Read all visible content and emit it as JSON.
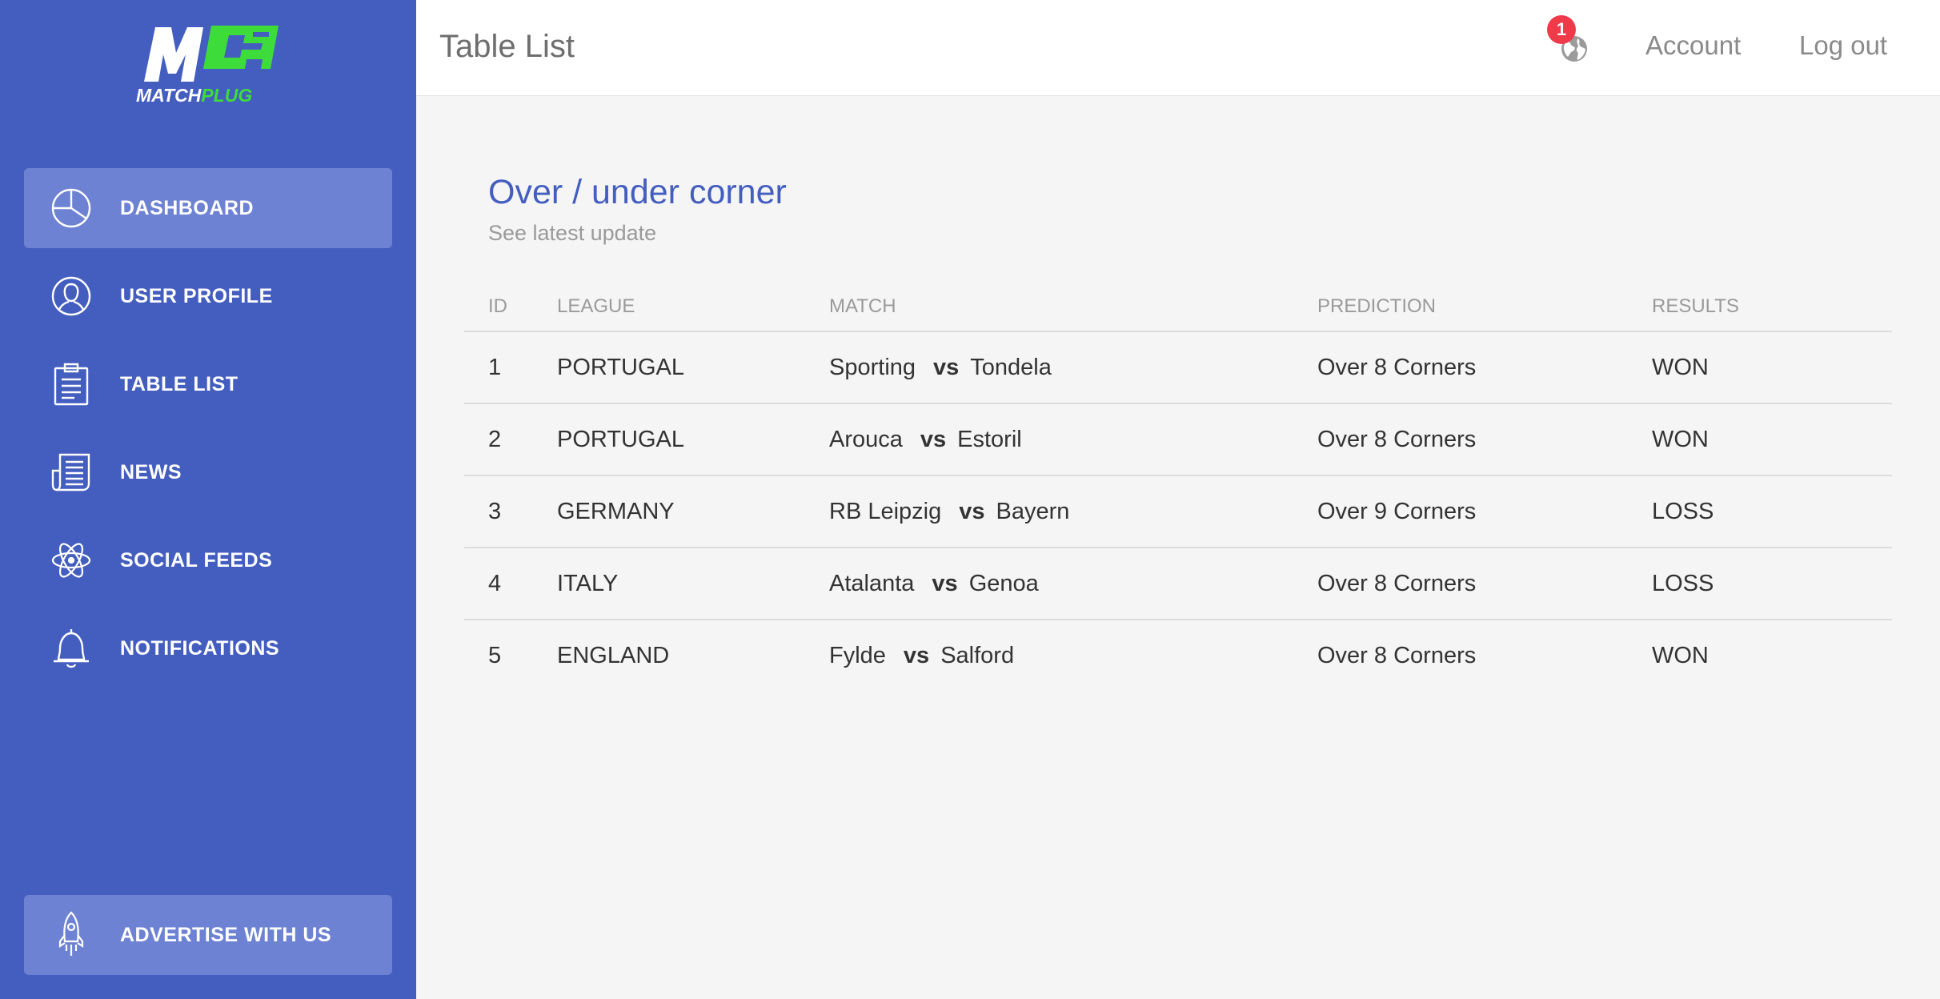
{
  "brand": {
    "logo_letters": "M",
    "word_part1": "MATCH",
    "word_part2": "PLUG",
    "green": "#3ddc3a"
  },
  "sidebar": {
    "background": "#445ec0",
    "items": [
      {
        "label": "DASHBOARD",
        "icon": "pie-chart-icon",
        "active": true
      },
      {
        "label": "USER PROFILE",
        "icon": "user-icon",
        "active": false
      },
      {
        "label": "TABLE LIST",
        "icon": "clipboard-icon",
        "active": false
      },
      {
        "label": "NEWS",
        "icon": "newspaper-icon",
        "active": false
      },
      {
        "label": "SOCIAL FEEDS",
        "icon": "atom-icon",
        "active": false
      },
      {
        "label": "NOTIFICATIONS",
        "icon": "bell-icon",
        "active": false
      }
    ],
    "advertise": {
      "label": "ADVERTISE WITH US",
      "icon": "rocket-icon"
    }
  },
  "header": {
    "title": "Table List",
    "notifications_count": "1",
    "account_label": "Account",
    "logout_label": "Log out"
  },
  "card": {
    "title": "Over / under corner",
    "subtitle": "See latest update"
  },
  "table": {
    "columns": [
      "ID",
      "LEAGUE",
      "MATCH",
      "PREDICTION",
      "RESULTS"
    ],
    "vs_label": "vs",
    "rows": [
      {
        "id": "1",
        "league": "PORTUGAL",
        "home": "Sporting",
        "away": "Tondela",
        "prediction": "Over 8 Corners",
        "result": "WON"
      },
      {
        "id": "2",
        "league": "PORTUGAL",
        "home": "Arouca",
        "away": "Estoril",
        "prediction": "Over 8 Corners",
        "result": "WON"
      },
      {
        "id": "3",
        "league": "GERMANY",
        "home": "RB Leipzig",
        "away": "Bayern",
        "prediction": "Over 9 Corners",
        "result": "LOSS"
      },
      {
        "id": "4",
        "league": "ITALY",
        "home": "Atalanta",
        "away": "Genoa",
        "prediction": "Over 8 Corners",
        "result": "LOSS"
      },
      {
        "id": "5",
        "league": "ENGLAND",
        "home": "Fylde",
        "away": "Salford",
        "prediction": "Over 8 Corners",
        "result": "WON"
      }
    ]
  }
}
